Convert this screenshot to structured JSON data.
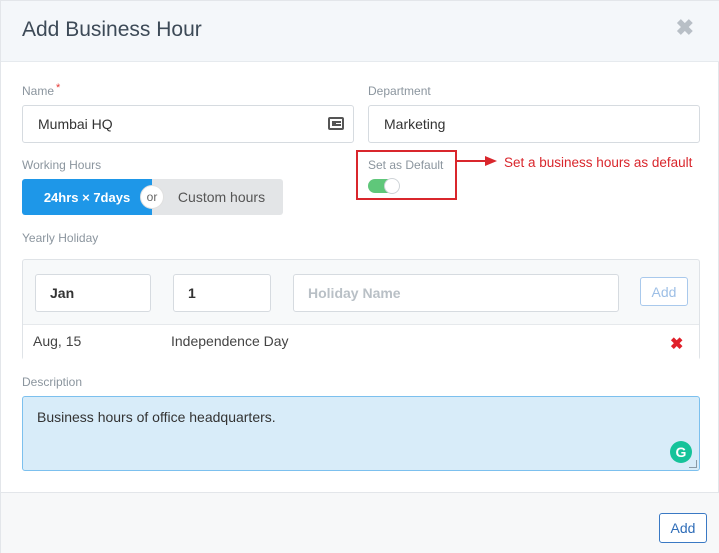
{
  "modal": {
    "title": "Add Business Hour",
    "close_symbol": "✖"
  },
  "form": {
    "name_label": "Name",
    "name_required_mark": "*",
    "name_value": "Mumbai HQ",
    "department_label": "Department",
    "department_value": "Marketing",
    "working_hours_label": "Working Hours",
    "option_24x7": "24hrs × 7days",
    "option_or": "or",
    "option_custom": "Custom hours",
    "set_default_label": "Set as Default",
    "set_default_on": true,
    "yearly_holiday_label": "Yearly Holiday",
    "holiday_month_value": "Jan",
    "holiday_day_value": "1",
    "holiday_name_placeholder": "Holiday Name",
    "holiday_add_label": "Add",
    "holidays": [
      {
        "date": "Aug, 15",
        "name": "Independence Day",
        "delete_symbol": "✖"
      }
    ],
    "description_label": "Description",
    "description_value": "Business hours of office headquarters."
  },
  "annotation": {
    "text": "Set a business hours as default"
  },
  "footer": {
    "add_label": "Add"
  },
  "icons": {
    "name_field_icon": "contact-card-icon",
    "grammarly_icon": "grammarly-icon",
    "grammarly_glyph": "G"
  },
  "colors": {
    "primary": "#1e97e8",
    "toggle_on": "#5fc77a",
    "annotation_red": "#d9262c",
    "delete_red": "#e0202a"
  }
}
